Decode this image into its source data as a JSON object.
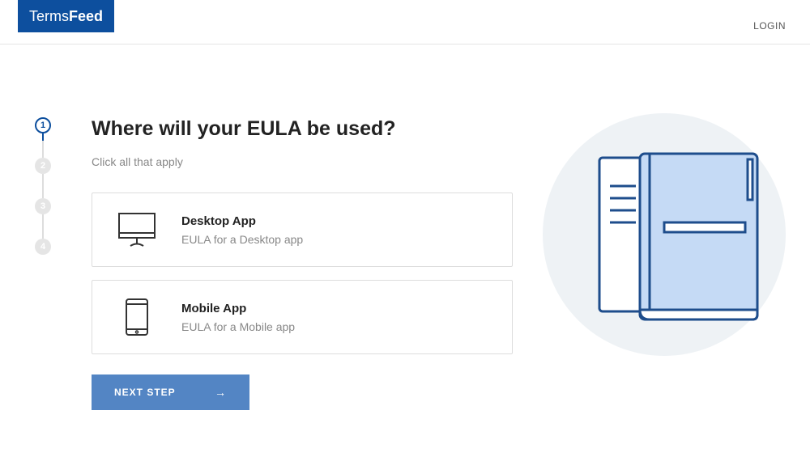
{
  "header": {
    "logo_first": "Terms",
    "logo_second": "Feed",
    "login": "LOGIN"
  },
  "stepper": {
    "steps": [
      "1",
      "2",
      "3",
      "4"
    ],
    "active_index": 0
  },
  "content": {
    "title": "Where will your EULA be used?",
    "subtitle": "Click all that apply",
    "options": [
      {
        "title": "Desktop App",
        "desc": "EULA for a Desktop app"
      },
      {
        "title": "Mobile App",
        "desc": "EULA for a Mobile app"
      }
    ],
    "next_button": "NEXT STEP"
  }
}
